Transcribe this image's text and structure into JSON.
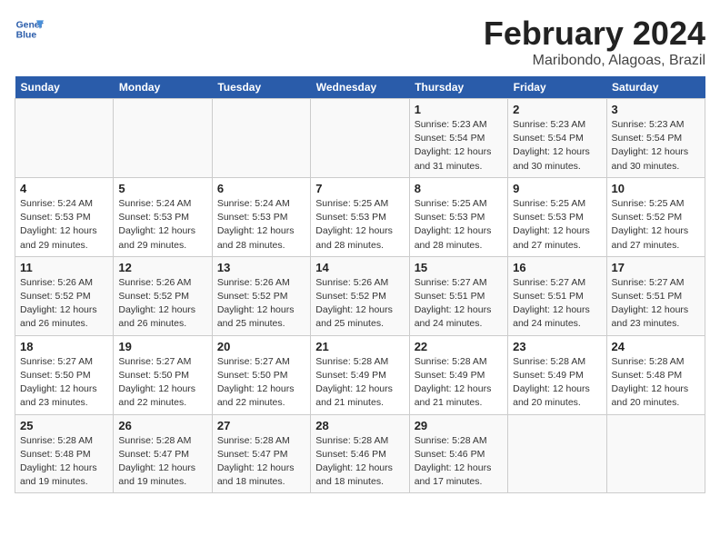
{
  "header": {
    "logo_line1": "General",
    "logo_line2": "Blue",
    "month_title": "February 2024",
    "location": "Maribondo, Alagoas, Brazil"
  },
  "weekdays": [
    "Sunday",
    "Monday",
    "Tuesday",
    "Wednesday",
    "Thursday",
    "Friday",
    "Saturday"
  ],
  "weeks": [
    [
      {
        "day": "",
        "info": ""
      },
      {
        "day": "",
        "info": ""
      },
      {
        "day": "",
        "info": ""
      },
      {
        "day": "",
        "info": ""
      },
      {
        "day": "1",
        "info": "Sunrise: 5:23 AM\nSunset: 5:54 PM\nDaylight: 12 hours and 31 minutes."
      },
      {
        "day": "2",
        "info": "Sunrise: 5:23 AM\nSunset: 5:54 PM\nDaylight: 12 hours and 30 minutes."
      },
      {
        "day": "3",
        "info": "Sunrise: 5:23 AM\nSunset: 5:54 PM\nDaylight: 12 hours and 30 minutes."
      }
    ],
    [
      {
        "day": "4",
        "info": "Sunrise: 5:24 AM\nSunset: 5:53 PM\nDaylight: 12 hours and 29 minutes."
      },
      {
        "day": "5",
        "info": "Sunrise: 5:24 AM\nSunset: 5:53 PM\nDaylight: 12 hours and 29 minutes."
      },
      {
        "day": "6",
        "info": "Sunrise: 5:24 AM\nSunset: 5:53 PM\nDaylight: 12 hours and 28 minutes."
      },
      {
        "day": "7",
        "info": "Sunrise: 5:25 AM\nSunset: 5:53 PM\nDaylight: 12 hours and 28 minutes."
      },
      {
        "day": "8",
        "info": "Sunrise: 5:25 AM\nSunset: 5:53 PM\nDaylight: 12 hours and 28 minutes."
      },
      {
        "day": "9",
        "info": "Sunrise: 5:25 AM\nSunset: 5:53 PM\nDaylight: 12 hours and 27 minutes."
      },
      {
        "day": "10",
        "info": "Sunrise: 5:25 AM\nSunset: 5:52 PM\nDaylight: 12 hours and 27 minutes."
      }
    ],
    [
      {
        "day": "11",
        "info": "Sunrise: 5:26 AM\nSunset: 5:52 PM\nDaylight: 12 hours and 26 minutes."
      },
      {
        "day": "12",
        "info": "Sunrise: 5:26 AM\nSunset: 5:52 PM\nDaylight: 12 hours and 26 minutes."
      },
      {
        "day": "13",
        "info": "Sunrise: 5:26 AM\nSunset: 5:52 PM\nDaylight: 12 hours and 25 minutes."
      },
      {
        "day": "14",
        "info": "Sunrise: 5:26 AM\nSunset: 5:52 PM\nDaylight: 12 hours and 25 minutes."
      },
      {
        "day": "15",
        "info": "Sunrise: 5:27 AM\nSunset: 5:51 PM\nDaylight: 12 hours and 24 minutes."
      },
      {
        "day": "16",
        "info": "Sunrise: 5:27 AM\nSunset: 5:51 PM\nDaylight: 12 hours and 24 minutes."
      },
      {
        "day": "17",
        "info": "Sunrise: 5:27 AM\nSunset: 5:51 PM\nDaylight: 12 hours and 23 minutes."
      }
    ],
    [
      {
        "day": "18",
        "info": "Sunrise: 5:27 AM\nSunset: 5:50 PM\nDaylight: 12 hours and 23 minutes."
      },
      {
        "day": "19",
        "info": "Sunrise: 5:27 AM\nSunset: 5:50 PM\nDaylight: 12 hours and 22 minutes."
      },
      {
        "day": "20",
        "info": "Sunrise: 5:27 AM\nSunset: 5:50 PM\nDaylight: 12 hours and 22 minutes."
      },
      {
        "day": "21",
        "info": "Sunrise: 5:28 AM\nSunset: 5:49 PM\nDaylight: 12 hours and 21 minutes."
      },
      {
        "day": "22",
        "info": "Sunrise: 5:28 AM\nSunset: 5:49 PM\nDaylight: 12 hours and 21 minutes."
      },
      {
        "day": "23",
        "info": "Sunrise: 5:28 AM\nSunset: 5:49 PM\nDaylight: 12 hours and 20 minutes."
      },
      {
        "day": "24",
        "info": "Sunrise: 5:28 AM\nSunset: 5:48 PM\nDaylight: 12 hours and 20 minutes."
      }
    ],
    [
      {
        "day": "25",
        "info": "Sunrise: 5:28 AM\nSunset: 5:48 PM\nDaylight: 12 hours and 19 minutes."
      },
      {
        "day": "26",
        "info": "Sunrise: 5:28 AM\nSunset: 5:47 PM\nDaylight: 12 hours and 19 minutes."
      },
      {
        "day": "27",
        "info": "Sunrise: 5:28 AM\nSunset: 5:47 PM\nDaylight: 12 hours and 18 minutes."
      },
      {
        "day": "28",
        "info": "Sunrise: 5:28 AM\nSunset: 5:46 PM\nDaylight: 12 hours and 18 minutes."
      },
      {
        "day": "29",
        "info": "Sunrise: 5:28 AM\nSunset: 5:46 PM\nDaylight: 12 hours and 17 minutes."
      },
      {
        "day": "",
        "info": ""
      },
      {
        "day": "",
        "info": ""
      }
    ]
  ]
}
